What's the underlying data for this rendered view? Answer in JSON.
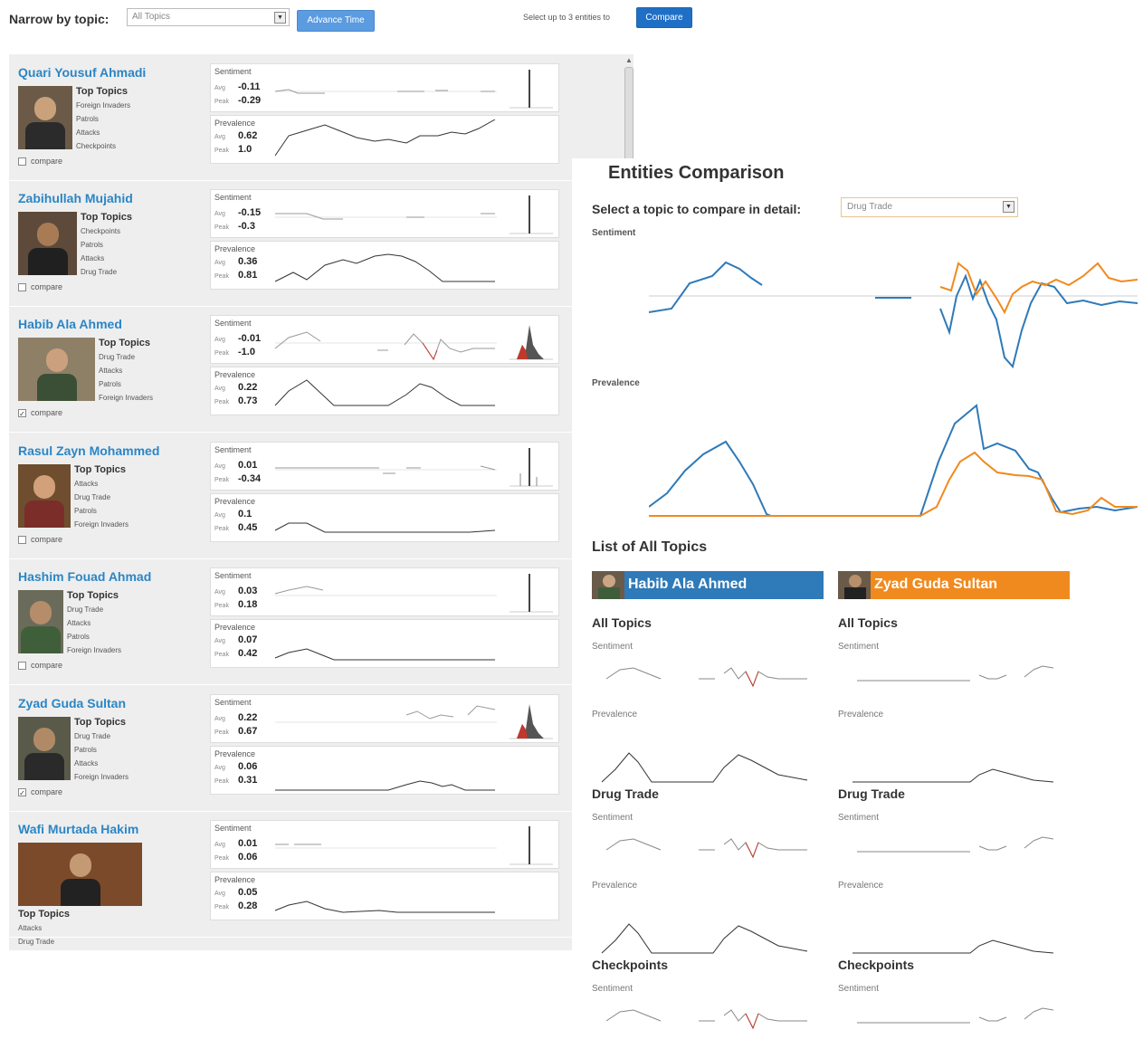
{
  "toolbar": {
    "narrow_label": "Narrow by topic:",
    "topic_value": "All Topics",
    "advance_label": "Advance Time",
    "select_hint": "Select up to 3 entities to",
    "compare_label": "Compare"
  },
  "labels": {
    "top_topics": "Top Topics",
    "compare": "compare",
    "sentiment": "Sentiment",
    "prevalence": "Prevalence",
    "avg": "Avg",
    "peak": "Peak"
  },
  "entities": [
    {
      "name": "Quari Yousuf Ahmadi",
      "topics": [
        "Foreign Invaders",
        "Patrols",
        "Attacks",
        "Checkpoints"
      ],
      "checked": false,
      "s_avg": "-0.11",
      "s_peak": "-0.29",
      "p_avg": "0.62",
      "p_peak": "1.0"
    },
    {
      "name": "Zabihullah Mujahid",
      "topics": [
        "Checkpoints",
        "Patrols",
        "Attacks",
        "Drug Trade"
      ],
      "checked": false,
      "s_avg": "-0.15",
      "s_peak": "-0.3",
      "p_avg": "0.36",
      "p_peak": "0.81"
    },
    {
      "name": "Habib Ala Ahmed",
      "topics": [
        "Drug Trade",
        "Attacks",
        "Patrols",
        "Foreign Invaders"
      ],
      "checked": true,
      "s_avg": "-0.01",
      "s_peak": "-1.0",
      "p_avg": "0.22",
      "p_peak": "0.73"
    },
    {
      "name": "Rasul Zayn Mohammed",
      "topics": [
        "Attacks",
        "Drug Trade",
        "Patrols",
        "Foreign Invaders"
      ],
      "checked": false,
      "s_avg": "0.01",
      "s_peak": "-0.34",
      "p_avg": "0.1",
      "p_peak": "0.45"
    },
    {
      "name": "Hashim Fouad Ahmad",
      "topics": [
        "Drug Trade",
        "Attacks",
        "Patrols",
        "Foreign Invaders"
      ],
      "checked": false,
      "s_avg": "0.03",
      "s_peak": "0.18",
      "p_avg": "0.07",
      "p_peak": "0.42"
    },
    {
      "name": "Zyad Guda Sultan",
      "topics": [
        "Drug Trade",
        "Patrols",
        "Attacks",
        "Foreign Invaders"
      ],
      "checked": true,
      "s_avg": "0.22",
      "s_peak": "0.67",
      "p_avg": "0.06",
      "p_peak": "0.31"
    },
    {
      "name": "Wafi Murtada Hakim",
      "topics": [
        "Attacks",
        "Drug Trade"
      ],
      "checked": null,
      "s_avg": "0.01",
      "s_peak": "0.06",
      "p_avg": "0.05",
      "p_peak": "0.28"
    }
  ],
  "comparison": {
    "title": "Entities Comparison",
    "select_label": "Select a topic to compare in detail:",
    "selected_topic": "Drug Trade",
    "sentiment_label": "Sentiment",
    "prevalence_label": "Prevalence",
    "list_title": "List of All Topics",
    "entity_a": "Habib Ala Ahmed",
    "entity_b": "Zyad Guda Sultan",
    "color_a": "#2f7ab8",
    "color_b": "#f08a1e",
    "topic_sections": [
      "All Topics",
      "Drug Trade",
      "Checkpoints"
    ]
  }
}
